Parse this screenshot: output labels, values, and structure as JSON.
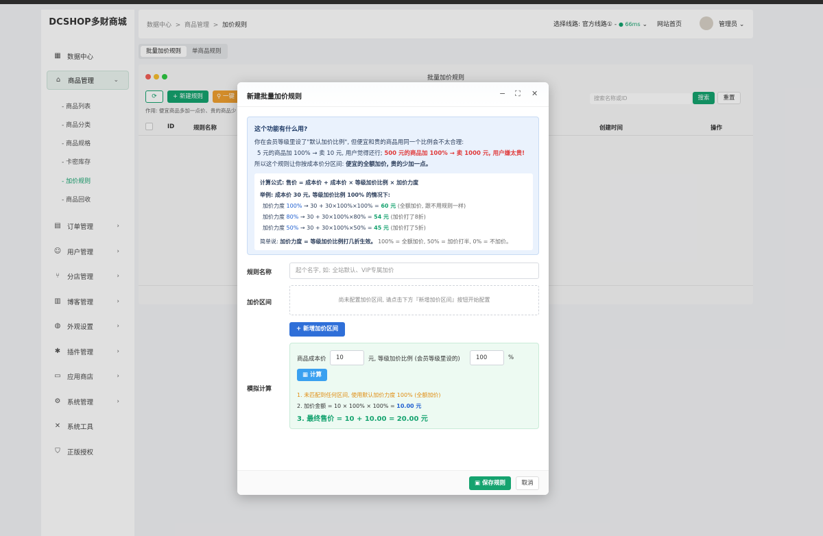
{
  "app": {
    "logo": "DCSHOP多财商城"
  },
  "sidebar": {
    "items": [
      {
        "label": "数据中心",
        "icon": "grid-icon"
      },
      {
        "label": "商品管理",
        "icon": "bag-icon"
      },
      {
        "label": "订单管理",
        "icon": "order-icon"
      },
      {
        "label": "用户管理",
        "icon": "user-icon"
      },
      {
        "label": "分店管理",
        "icon": "branch-icon"
      },
      {
        "label": "博客管理",
        "icon": "blog-icon"
      },
      {
        "label": "外观设置",
        "icon": "palette-icon"
      },
      {
        "label": "插件管理",
        "icon": "plugin-icon"
      },
      {
        "label": "应用商店",
        "icon": "store-icon"
      },
      {
        "label": "系统管理",
        "icon": "gear-icon"
      },
      {
        "label": "系统工具",
        "icon": "tools-icon"
      },
      {
        "label": "正版授权",
        "icon": "shield-icon"
      }
    ],
    "sub_items": [
      "商品列表",
      "商品分类",
      "商品规格",
      "卡密库存",
      "加价规则",
      "商品回收"
    ]
  },
  "header": {
    "crumb_1": "数据中心",
    "crumb_2": "商品管理",
    "crumb_3": "加价规则",
    "sep": ">",
    "line_label": "选择线路: 官方线路① -",
    "line_ms": "● 66ms",
    "home": "网站首页",
    "user": "管理员"
  },
  "tabs": {
    "batch": "批量加价规则",
    "single": "单商品规则"
  },
  "card": {
    "title": "批量加价规则",
    "new_btn": "+ 新建规则",
    "one_btn": "一键",
    "usage": "作用: 便宜商品多加一点价、贵的商品少",
    "search_placeholder": "搜索名称或ID",
    "search_btn": "搜索",
    "reset_btn": "重置",
    "col_id": "ID",
    "col_name": "规则名称",
    "col_created": "创建时间",
    "col_ops": "操作"
  },
  "modal": {
    "title": "新建批量加价规则",
    "info": {
      "q": "这个功能有什么用?",
      "l1": "你在会员等级里设了\"默认加价比例\", 但便宜和贵的商品用同一个比例会不太合理:",
      "l2a": "5 元的商品加 100% → 卖 10 元, 用户觉得还行;",
      "l2b": "500 元的商品加 100% → 卖 1000 元, 用户嫌太贵!",
      "l3a": "所以这个规则让你按成本价分区间:",
      "l3b": "便宜的全额加价, 贵的少加一点。",
      "formula": "计算公式: 售价 = 成本价 + 成本价 × 等级加价比例 × 加价力度",
      "ex_title": "举例: 成本价 30 元, 等级加价比例 100% 的情况下:",
      "ex1a": "加价力度",
      "ex1p": "100%",
      "ex1b": "→ 30 + 30×100%×100% =",
      "ex1v": "60 元",
      "ex1c": "(全额加价, 跟不用规则一样)",
      "ex2a": "加价力度",
      "ex2p": "80%",
      "ex2b": "→ 30 + 30×100%×80% =",
      "ex2v": "54 元",
      "ex2c": "(加价打了8折)",
      "ex3a": "加价力度",
      "ex3p": "50%",
      "ex3b": "→ 30 + 30×100%×50% =",
      "ex3v": "45 元",
      "ex3c": "(加价打了5折)",
      "summary_a": "简单说:",
      "summary_b": "加价力度 = 等级加价比例打几折生效。",
      "summary_c": "100% = 全额加价, 50% = 加价打半, 0% = 不加价。"
    },
    "name_label": "规则名称",
    "name_placeholder": "起个名字, 如: 全站默认、VIP专属加价",
    "range_label": "加价区间",
    "range_empty": "尚未配置加价区间, 请点击下方『新增加价区间』按钮开始配置",
    "add_range_btn": "+ 新增加价区间",
    "sim_label": "模拟计算",
    "sim": {
      "cost_label": "商品成本价",
      "cost_value": "10",
      "unit_yuan": "元, 等级加价比例 (会员等级里设的)",
      "ratio_value": "100",
      "unit_pct": "%",
      "calc_btn": "计算",
      "r1": "1. 未匹配到任何区间, 使用默认加价力度 100% (全额加价)",
      "r2a": "2. 加价金额 = 10 × 100% × 100% =",
      "r2b": "10.00 元",
      "r3": "3. 最终售价 = 10 + 10.00 = 20.00 元"
    },
    "save_btn": "保存规则",
    "cancel_btn": "取消"
  }
}
